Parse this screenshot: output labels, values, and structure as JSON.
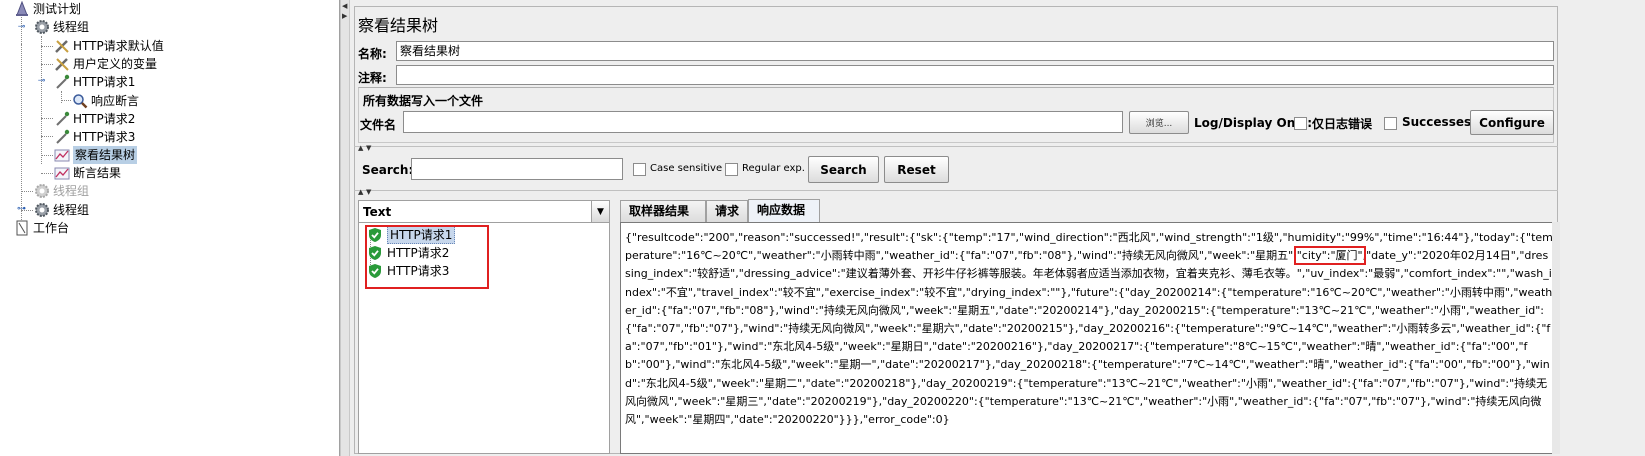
{
  "tree": {
    "root": "测试计划",
    "thread_group_1": "线程组",
    "http_defaults": "HTTP请求默认值",
    "user_vars": "用户定义的变量",
    "http_request_1": "HTTP请求1",
    "response_assertion": "响应断言",
    "http_request_2": "HTTP请求2",
    "http_request_3": "HTTP请求3",
    "view_results_tree": "察看结果树",
    "assertion_results": "断言结果",
    "thread_group_2": "线程组",
    "thread_group_3": "线程组",
    "workbench": "工作台"
  },
  "panel": {
    "title": "察看结果树",
    "name_label": "名称:",
    "name_value": "察看结果树",
    "comment_label": "注释:",
    "comment_value": "",
    "file_group_title": "所有数据写入一个文件",
    "filename_label": "文件名",
    "filename_value": "",
    "browse_label": "浏览...",
    "log_display_label": "Log/Display Only:",
    "errors_only_label": "仅日志错误",
    "successes_label": "Successes",
    "configure_label": "Configure"
  },
  "search": {
    "label": "Search:",
    "value": "",
    "case_sensitive_label": "Case sensitive",
    "regex_label": "Regular exp.",
    "search_button": "Search",
    "reset_button": "Reset"
  },
  "results": {
    "renderer": "Text",
    "items": [
      "HTTP请求1",
      "HTTP请求2",
      "HTTP请求3"
    ],
    "tabs": [
      "取样器结果",
      "请求",
      "响应数据"
    ],
    "active_tab": "响应数据",
    "response_text_before": "{\"resultcode\":\"200\",\"reason\":\"successed!\",\"result\":{\"sk\":{\"temp\":\"17\",\"wind_direction\":\"西北风\",\"wind_strength\":\"1级\",\"humidity\":\"99%\",\"time\":\"16:44\"},\"today\":{\"temperature\":\"16℃~20℃\",\"weather\":\"小雨转中雨\",\"weather_id\":{\"fa\":\"07\",\"fb\":\"08\"},\"wind\":\"持续无风向微风\",\"week\":\"星期五\",",
    "response_highlight": "\"city\":\"厦门\"",
    "response_text_after": ",\"date_y\":\"2020年02月14日\",\"dressing_index\":\"较舒适\",\"dressing_advice\":\"建议着薄外套、开衫牛仔衫裤等服装。年老体弱者应适当添加衣物，宜着夹克衫、薄毛衣等。\",\"uv_index\":\"最弱\",\"comfort_index\":\"\",\"wash_index\":\"不宜\",\"travel_index\":\"较不宜\",\"exercise_index\":\"较不宜\",\"drying_index\":\"\"},\"future\":{\"day_20200214\":{\"temperature\":\"16℃~20℃\",\"weather\":\"小雨转中雨\",\"weather_id\":{\"fa\":\"07\",\"fb\":\"08\"},\"wind\":\"持续无风向微风\",\"week\":\"星期五\",\"date\":\"20200214\"},\"day_20200215\":{\"temperature\":\"13℃~21℃\",\"weather\":\"小雨\",\"weather_id\":{\"fa\":\"07\",\"fb\":\"07\"},\"wind\":\"持续无风向微风\",\"week\":\"星期六\",\"date\":\"20200215\"},\"day_20200216\":{\"temperature\":\"9℃~14℃\",\"weather\":\"小雨转多云\",\"weather_id\":{\"fa\":\"07\",\"fb\":\"01\"},\"wind\":\"东北风4-5级\",\"week\":\"星期日\",\"date\":\"20200216\"},\"day_20200217\":{\"temperature\":\"8℃~15℃\",\"weather\":\"晴\",\"weather_id\":{\"fa\":\"00\",\"fb\":\"00\"},\"wind\":\"东北风4-5级\",\"week\":\"星期一\",\"date\":\"20200217\"},\"day_20200218\":{\"temperature\":\"7℃~14℃\",\"weather\":\"晴\",\"weather_id\":{\"fa\":\"00\",\"fb\":\"00\"},\"wind\":\"东北风4-5级\",\"week\":\"星期二\",\"date\":\"20200218\"},\"day_20200219\":{\"temperature\":\"13℃~21℃\",\"weather\":\"小雨\",\"weather_id\":{\"fa\":\"07\",\"fb\":\"07\"},\"wind\":\"持续无风向微风\",\"week\":\"星期三\",\"date\":\"20200219\"},\"day_20200220\":{\"temperature\":\"13℃~21℃\",\"weather\":\"小雨\",\"weather_id\":{\"fa\":\"07\",\"fb\":\"07\"},\"wind\":\"持续无风向微风\",\"week\":\"星期四\",\"date\":\"20200220\"}}},\"error_code\":0}"
  },
  "colors": {
    "highlight_box": "#e02020",
    "selection": "#b8cfe5",
    "success_shield": "#2a9a3a"
  }
}
